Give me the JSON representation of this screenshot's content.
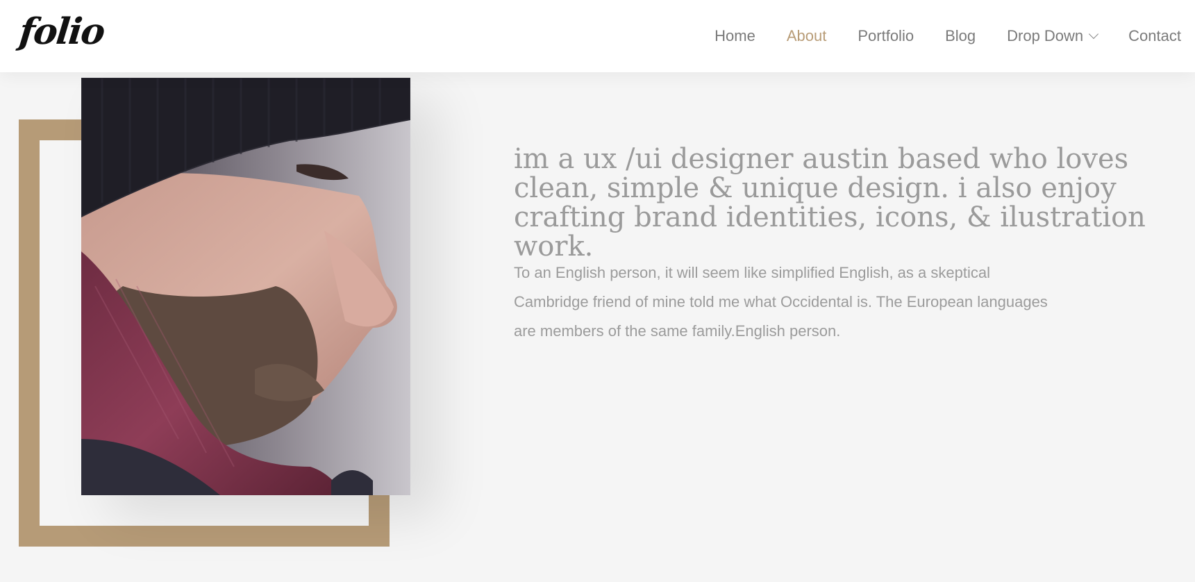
{
  "header": {
    "logo_text": "folio",
    "nav": [
      {
        "label": "Home",
        "active": false
      },
      {
        "label": "About",
        "active": true
      },
      {
        "label": "Portfolio",
        "active": false
      },
      {
        "label": "Blog",
        "active": false
      },
      {
        "label": "Drop Down",
        "active": false,
        "has_dropdown": true
      },
      {
        "label": "Contact",
        "active": false
      }
    ]
  },
  "about": {
    "photo_alt": "portrait",
    "headline": "im a ux /ui designer austin based who loves clean, simple & unique design. i also enjoy crafting brand identities, icons, & ilustration work.",
    "body": "To an English person, it will seem like simplified English, as a skeptical Cambridge friend of mine told me what Occidental is. The European languages are members of the same family.English person."
  },
  "colors": {
    "accent": "#b89c77",
    "frame": "#b69b77",
    "text_muted": "#9a9a9a",
    "nav_text": "#7a7a7a",
    "background": "#f5f5f5",
    "header_bg": "#ffffff"
  }
}
